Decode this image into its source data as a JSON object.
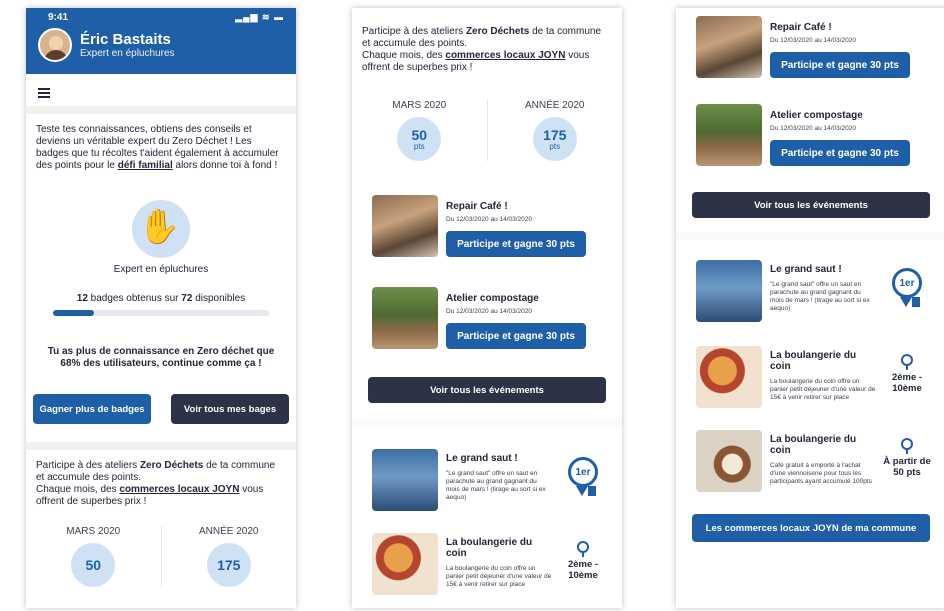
{
  "screen1": {
    "status_time": "9:41",
    "status_icons": "▂▄▆ ≋ ▬",
    "user_name": "Éric Bastaits",
    "user_title": "Expert en épluchures",
    "intro_part1": "Teste tes connaissances, obtiens des conseils et deviens un véritable expert du Zero Déchet ! Les badges que tu récoltes t'aident également à accumuler des points pour le ",
    "intro_link": "défi familial",
    "intro_part2": " alors donne toi à fond !",
    "badge_label": "Expert en épluchures",
    "badges_obtained": "12",
    "badges_middle": " badges obtenus sur ",
    "badges_total": "72",
    "badges_suffix": " disponibles",
    "badge_progress_fraction": 0.19,
    "motivation": "Tu as plus de connaissance en Zero déchet que 68% des utilisateurs, continue comme ça !",
    "btn_more_badges": "Gagner plus de badges",
    "btn_all_badges": "Voir tous mes bages",
    "events_intro_part1": "Participe à des ateliers ",
    "events_intro_bold": "Zero Déchets",
    "events_intro_part2": " de ta commune et accumule des points.",
    "events_intro_part3": "Chaque mois, des ",
    "events_intro_link": "commerces locaux JOYN",
    "events_intro_part4": " vous offrent de superbes prix !",
    "stat_month_label": "MARS 2020",
    "stat_month_value": "50",
    "stat_year_label": "ANNÉE 2020",
    "stat_year_value": "175"
  },
  "screen2": {
    "events_intro_part1": "Participe à des ateliers ",
    "events_intro_bold": "Zero Déchets",
    "events_intro_part2": " de ta commune et accumule des points.",
    "events_intro_part3": "Chaque mois, des ",
    "events_intro_link": "commerces locaux JOYN",
    "events_intro_part4": " vous offrent de superbes prix !",
    "stat_month_label": "MARS 2020",
    "stat_month_value": "50",
    "stat_unit": "pts",
    "stat_year_label": "ANNÉE 2020",
    "stat_year_value": "175",
    "events": [
      {
        "title": "Repair Café !",
        "date": "Du 12/03/2020 au 14/03/2020",
        "button": "Participe et gagne 30 pts"
      },
      {
        "title": "Atelier compostage",
        "date": "Du 12/03/2020 au 14/03/2020",
        "button": "Participe et gagne 30 pts"
      }
    ],
    "all_events_button": "Voir tous les événements",
    "rewards": [
      {
        "title": "Le grand saut !",
        "desc": "\"Le grand saut\" offre un saut en parachute au grand gagnant du mois de mars ! (tirage au sort si ex aequo)",
        "rank": "1er"
      },
      {
        "title": "La boulangerie du coin",
        "desc": "La boulangerie du coin offre un panier petit déjeuner d'une valeur de 15€ à venir retirer sur place",
        "rank": "2ème - 10ème"
      }
    ]
  },
  "screen3": {
    "events": [
      {
        "title": "Repair Café !",
        "date": "Du 12/03/2020 au 14/03/2020",
        "button": "Participe et gagne 30 pts"
      },
      {
        "title": "Atelier compostage",
        "date": "Du 12/03/2020 au 14/03/2020",
        "button": "Participe et gagne 30 pts"
      }
    ],
    "all_events_button": "Voir tous les événements",
    "rewards": [
      {
        "title": "Le grand saut !",
        "desc": "\"Le grand saut\" offre un saut en parachute au grand gagnant du mois de mars ! (tirage au sort si ex aequo)",
        "rank": "1er"
      },
      {
        "title": "La boulangerie du coin",
        "desc": "La boulangerie du coin offre un panier petit déjeuner d'une valeur de 15€ à venir retirer sur place",
        "rank": "2ème - 10ème"
      },
      {
        "title": "La boulangerie du coin",
        "desc": "Café gratuit à emporté à l'achat d'une viennoiserie pour tous les participants ayant accumulé 100pts",
        "rank": "À partir de 50 pts"
      }
    ],
    "commerces_button": "Les commerces locaux JOYN de ma commune"
  },
  "colors": {
    "primary": "#1f5fa8",
    "dark": "#2c3346",
    "light_blue": "#cfe1f4"
  }
}
